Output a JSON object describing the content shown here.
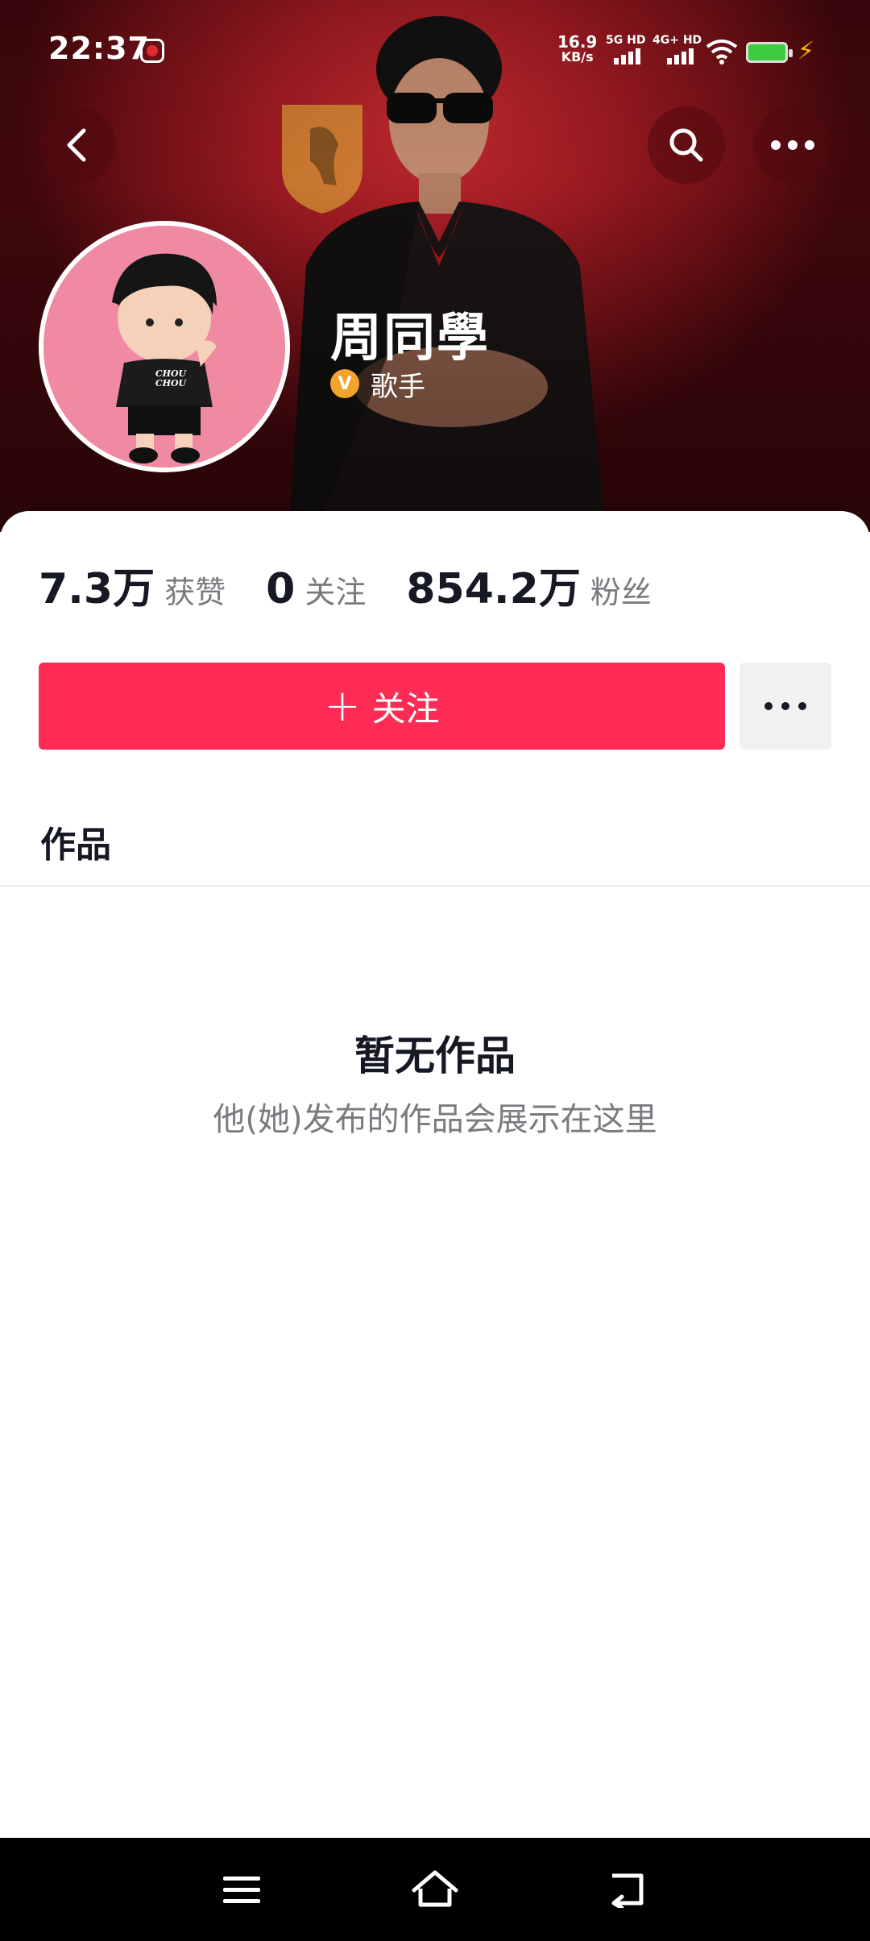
{
  "status_bar": {
    "time": "22:37",
    "net_speed_value": "16.9",
    "net_speed_unit": "KB/s",
    "sim1_label": "5G HD",
    "sim2_label": "4G+ HD"
  },
  "header": {
    "back_icon": "chevron-left-icon",
    "search_icon": "search-icon",
    "more_icon": "more-horizontal-icon"
  },
  "profile": {
    "name": "周同學",
    "verify_badge": "V",
    "verify_label": "歌手",
    "avatar_text": "CHOU CHOU"
  },
  "stats": [
    {
      "value": "7.3万",
      "label": "获赞"
    },
    {
      "value": "0",
      "label": "关注"
    },
    {
      "value": "854.2万",
      "label": "粉丝"
    }
  ],
  "actions": {
    "follow_plus": "+",
    "follow_label": "关注",
    "more_icon": "more-horizontal-icon"
  },
  "tabs": {
    "works": "作品"
  },
  "empty_state": {
    "title": "暂无作品",
    "subtitle": "他(她)发布的作品会展示在这里"
  },
  "colors": {
    "accent": "#fe2c55",
    "header_red": "#9b1a21",
    "text_primary": "#161823",
    "text_secondary": "#7a7b80"
  }
}
